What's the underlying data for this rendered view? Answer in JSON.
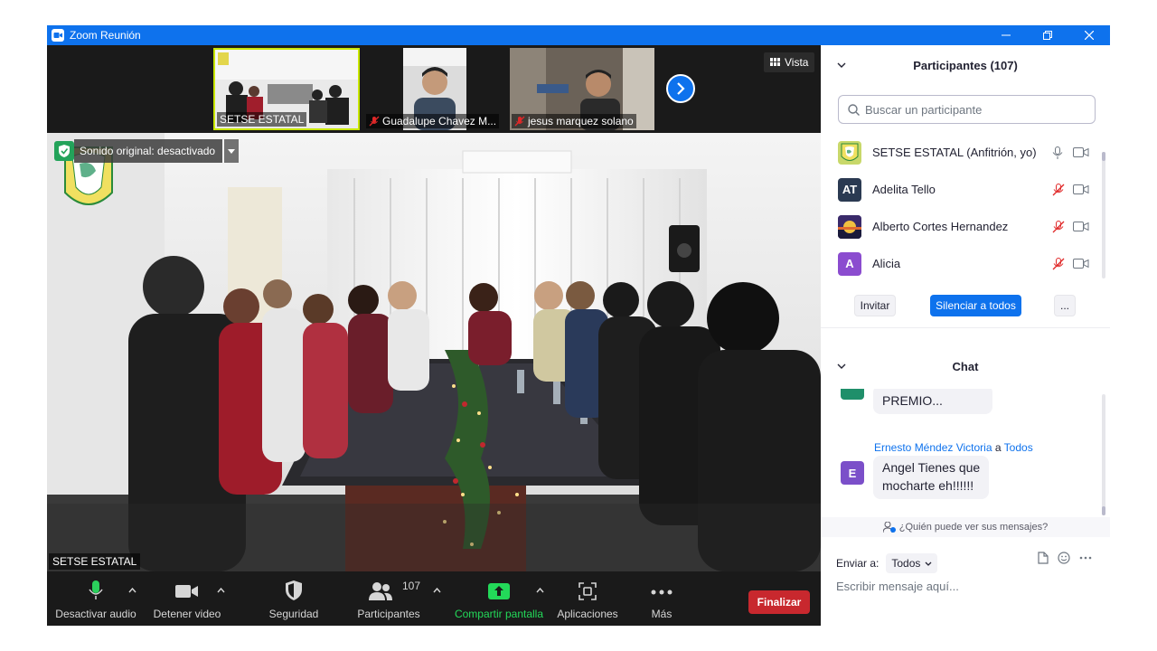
{
  "window": {
    "title": "Zoom Reunión"
  },
  "thumbnails": [
    {
      "name": "SETSE ESTATAL",
      "muted": false,
      "active": true
    },
    {
      "name": "Guadalupe Chavez M...",
      "muted": true,
      "active": false
    },
    {
      "name": "jesus marquez solano",
      "muted": true,
      "active": false
    }
  ],
  "view_button": "Vista",
  "original_sound": "Sonido original: desactivado",
  "main_speaker": "SETSE ESTATAL",
  "toolbar": {
    "mute": "Desactivar audio",
    "video": "Detener video",
    "security": "Seguridad",
    "participants": "Participantes",
    "participants_count": "107",
    "share": "Compartir pantalla",
    "apps": "Aplicaciones",
    "more": "Más",
    "end": "Finalizar"
  },
  "participants_panel": {
    "title": "Participantes (107)",
    "search_placeholder": "Buscar un participante",
    "list": [
      {
        "name": "SETSE ESTATAL (Anfitrión, yo)",
        "avatar": "",
        "avatar_color": "#c8d86a",
        "mic_muted": false
      },
      {
        "name": "Adelita Tello",
        "avatar": "AT",
        "avatar_color": "#2b3a52",
        "mic_muted": true
      },
      {
        "name": "Alberto Cortes Hernandez",
        "avatar": "",
        "avatar_color": "#4a2d7a",
        "mic_muted": true
      },
      {
        "name": "Alicia",
        "avatar": "A",
        "avatar_color": "#8b4ccf",
        "mic_muted": true
      }
    ],
    "invite": "Invitar",
    "mute_all": "Silenciar a todos",
    "more": "..."
  },
  "chat": {
    "title": "Chat",
    "messages": [
      {
        "sender": "",
        "to": "",
        "text_lines": [
          "PREMIO..."
        ],
        "avatar": "",
        "avatar_color": "#1f8f6a"
      },
      {
        "sender": "Ernesto Méndez Victoria",
        "to_word": "a",
        "to": "Todos",
        "text_lines": [
          "Angel Tienes que",
          "mocharte eh!!!!!!"
        ],
        "avatar": "E",
        "avatar_color": "#7b4fc9"
      }
    ],
    "who_sees": "¿Quién puede ver sus mensajes?",
    "send_to_label": "Enviar a:",
    "send_to_value": "Todos",
    "input_placeholder": "Escribir mensaje aquí..."
  },
  "colors": {
    "accent": "#0e72ed",
    "end": "#c8282e",
    "share": "#23d959"
  }
}
